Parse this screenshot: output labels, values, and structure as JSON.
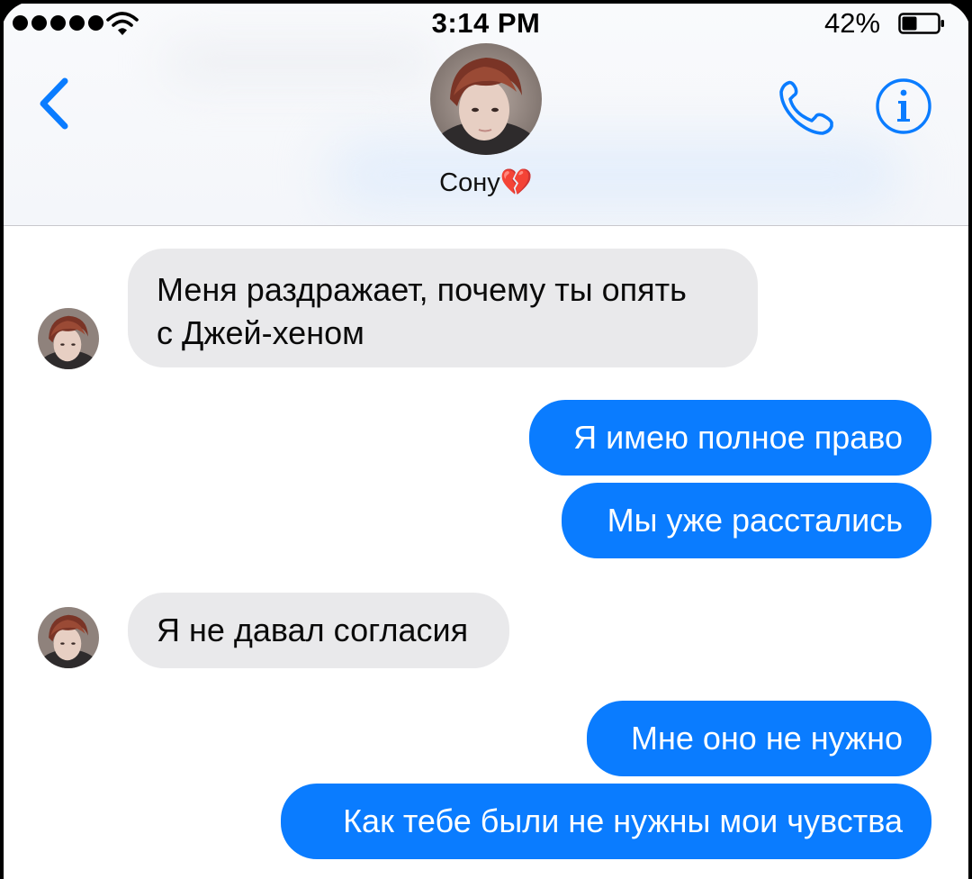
{
  "status_bar": {
    "time": "3:14 PM",
    "battery_percent": "42%",
    "battery_level": 0.42,
    "signal_icon": "signal-dots-icon",
    "wifi_icon": "wifi-icon"
  },
  "header": {
    "contact_name": "Сону💔",
    "back_icon": "chevron-left-icon",
    "call_icon": "phone-icon",
    "info_icon": "info-icon"
  },
  "colors": {
    "accent": "#0a7cff",
    "incoming_bubble": "#e9e9eb",
    "outgoing_text": "#ffffff"
  },
  "messages": [
    {
      "direction": "incoming",
      "lines": [
        "Меня раздражает, почему ты опять",
        "с Джей-хеном"
      ]
    },
    {
      "direction": "outgoing",
      "lines": [
        "Я имею полное право"
      ]
    },
    {
      "direction": "outgoing",
      "lines": [
        "Мы уже расстались"
      ]
    },
    {
      "direction": "incoming",
      "lines": [
        "Я не давал согласия"
      ]
    },
    {
      "direction": "outgoing",
      "lines": [
        "Мне оно не нужно"
      ]
    },
    {
      "direction": "outgoing",
      "lines": [
        "Как тебе были не нужны мои чувства"
      ]
    }
  ]
}
